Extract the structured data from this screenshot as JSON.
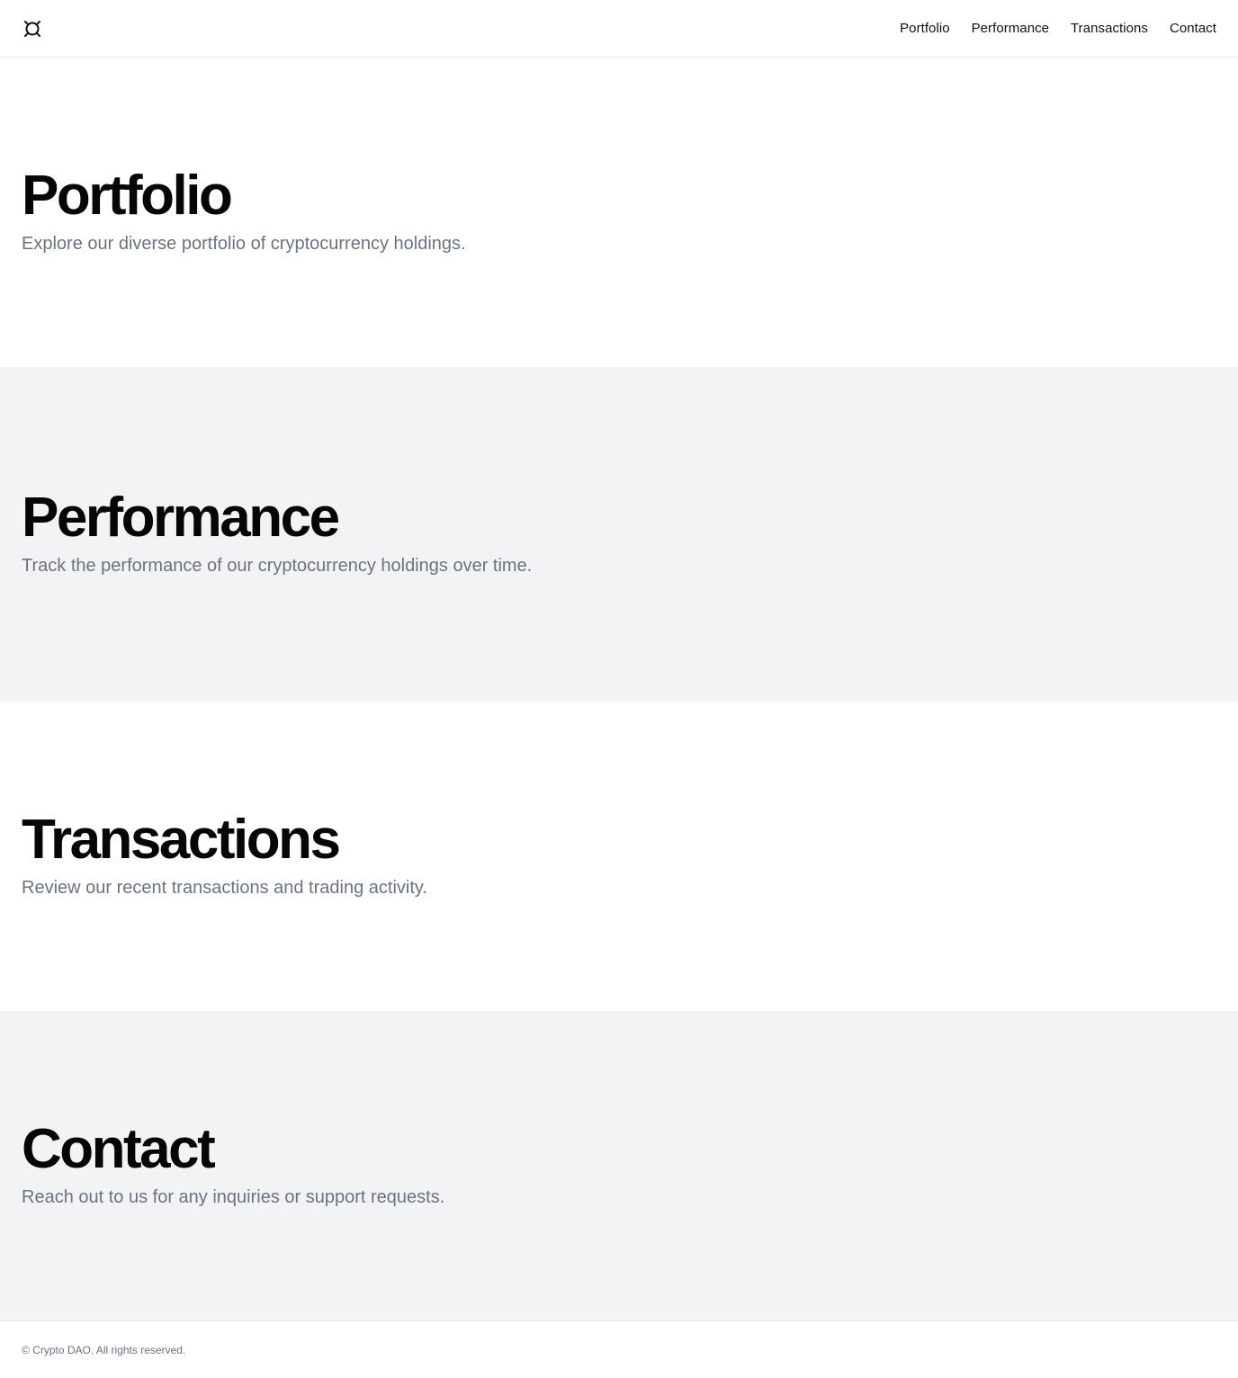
{
  "header": {
    "logo_icon": "crypto-logo-icon",
    "nav": [
      {
        "label": "Portfolio"
      },
      {
        "label": "Performance"
      },
      {
        "label": "Transactions"
      },
      {
        "label": "Contact"
      }
    ]
  },
  "sections": {
    "portfolio": {
      "title": "Portfolio",
      "description": "Explore our diverse portfolio of cryptocurrency holdings."
    },
    "performance": {
      "title": "Performance",
      "description": "Track the performance of our cryptocurrency holdings over time."
    },
    "transactions": {
      "title": "Transactions",
      "description": "Review our recent transactions and trading activity."
    },
    "contact": {
      "title": "Contact",
      "description": "Reach out to us for any inquiries or support requests."
    }
  },
  "footer": {
    "copyright": "© Crypto DAO. All rights reserved."
  },
  "colors": {
    "alt_section_bg": "#f2f3f5",
    "muted_text": "#6b7280",
    "border": "#e5e7eb"
  }
}
